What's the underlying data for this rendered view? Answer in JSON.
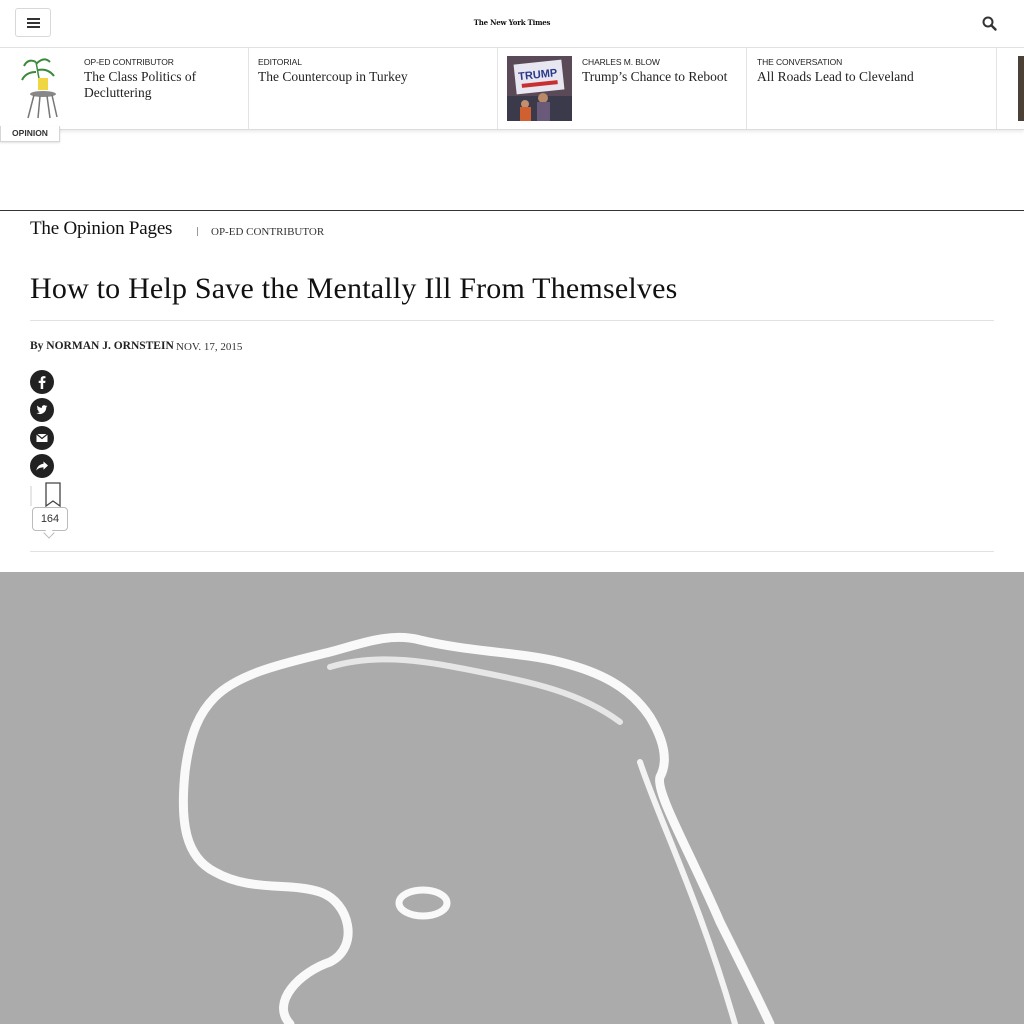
{
  "header": {
    "logo": "The New York Times",
    "menu_icon": "hamburger-menu-icon",
    "search_icon": "search-icon"
  },
  "ribbon": {
    "opinion_tab": "OPINION",
    "items": [
      {
        "kicker": "OP-ED CONTRIBUTOR",
        "headline": "The Class Politics of Decluttering"
      },
      {
        "kicker": "EDITORIAL",
        "headline": "The Countercoup in Turkey"
      },
      {
        "kicker": "CHARLES M. BLOW",
        "headline": "Trump’s Chance to Reboot",
        "thumb_sign": "TRUMP"
      },
      {
        "kicker": "THE CONVERSATION",
        "headline": "All Roads Lead to Cleveland"
      }
    ]
  },
  "section": {
    "name": "The Opinion Pages",
    "kicker": "OP-ED CONTRIBUTOR"
  },
  "article": {
    "headline": "How to Help Save the Mentally Ill From Themselves",
    "byline_prefix": "By",
    "author": "NORMAN J. ORNSTEIN",
    "date": "NOV. 17, 2015",
    "comment_count": "164"
  },
  "share_icons": [
    "facebook-icon",
    "twitter-icon",
    "email-icon",
    "share-icon",
    "bookmark-icon",
    "comment-icon"
  ],
  "colors": {
    "text": "#121212",
    "hero_background": "#ababab",
    "hero_drawing": "#ffffff"
  }
}
